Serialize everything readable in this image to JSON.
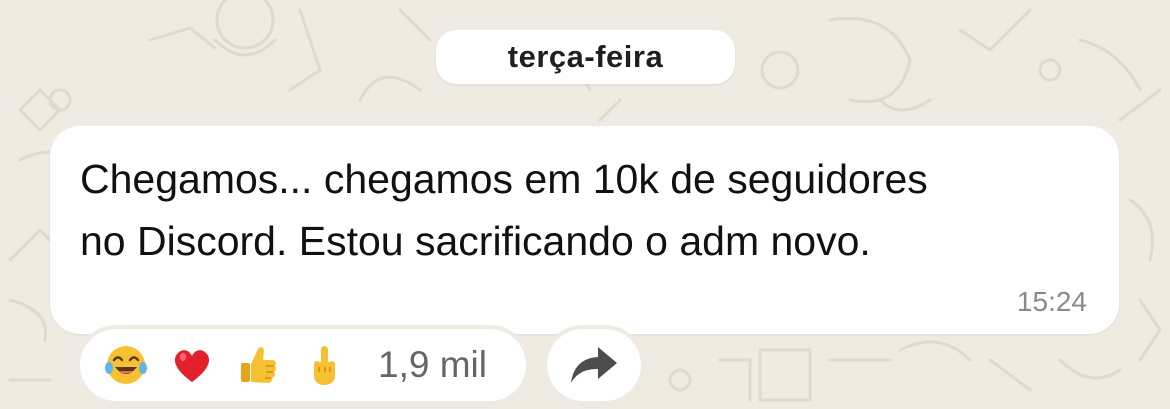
{
  "chat": {
    "date_label": "terça-feira",
    "message": {
      "text": "Chegamos... chegamos em 10k de seguidores\nno Discord. Estou sacrificando o adm novo.",
      "time": "15:24"
    },
    "reactions": {
      "emojis": [
        "laughing-tears-emoji",
        "red-heart-emoji",
        "thumbs-up-emoji",
        "middle-finger-emoji"
      ],
      "count": "1,9 mil"
    },
    "forward_icon": "forward-arrow-icon"
  },
  "colors": {
    "background": "#efeae2",
    "bubble": "#ffffff",
    "text": "#111111",
    "time": "#8a8a8a",
    "count": "#666666",
    "icon": "#4d4d4d"
  }
}
